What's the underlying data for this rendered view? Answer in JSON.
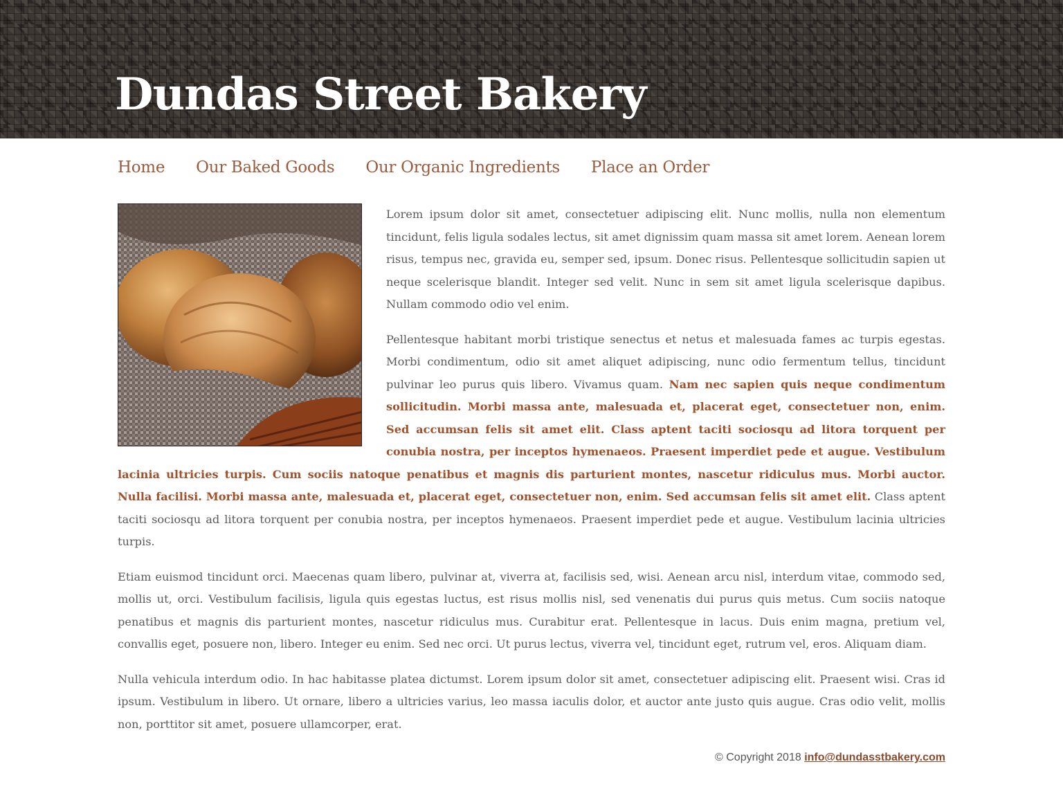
{
  "header": {
    "site_title": "Dundas Street Bakery"
  },
  "nav": {
    "items": [
      {
        "label": "Home"
      },
      {
        "label": "Our Baked Goods"
      },
      {
        "label": "Our Organic Ingredients"
      },
      {
        "label": "Place an Order"
      }
    ]
  },
  "content": {
    "image_subject": "bread-in-basket",
    "paragraphs": [
      {
        "text": "Lorem ipsum dolor sit amet, consectetuer adipiscing elit. Nunc mollis, nulla non elementum tincidunt, felis ligula sodales lectus, sit amet dignissim quam massa sit amet lorem. Aenean lorem risus, tempus nec, gravida eu, semper sed, ipsum. Donec risus. Pellentesque sollicitudin sapien ut neque scelerisque blandit. Integer sed velit. Nunc in sem sit amet ligula scelerisque dapibus. Nullam commodo odio vel enim."
      },
      {
        "before": "Pellentesque habitant morbi tristique senectus et netus et malesuada fames ac turpis egestas. Morbi condimentum, odio sit amet aliquet adipiscing, nunc odio fermentum tellus, tincidunt pulvinar leo purus quis libero. Vivamus quam. ",
        "highlight": "Nam nec sapien quis neque condimentum sollicitudin. Morbi massa ante, malesuada et, placerat eget, consectetuer non, enim. Sed accumsan felis sit amet elit. Class aptent taciti sociosqu ad litora torquent per conubia nostra, per inceptos hymenaeos. Praesent imperdiet pede et augue. Vestibulum lacinia ultricies turpis. Cum sociis natoque penatibus et magnis dis parturient montes, nascetur ridiculus mus. Morbi auctor. Nulla facilisi. Morbi massa ante, malesuada et, placerat eget, consectetuer non, enim. Sed accumsan felis sit amet elit.",
        "after": " Class aptent taciti sociosqu ad litora torquent per conubia nostra, per inceptos hymenaeos. Praesent imperdiet pede et augue. Vestibulum lacinia ultricies turpis."
      },
      {
        "text": "Etiam euismod tincidunt orci. Maecenas quam libero, pulvinar at, viverra at, facilisis sed, wisi. Aenean arcu nisl, interdum vitae, commodo sed, mollis ut, orci. Vestibulum facilisis, ligula quis egestas luctus, est risus mollis nisl, sed venenatis dui purus quis metus. Cum sociis natoque penatibus et magnis dis parturient montes, nascetur ridiculus mus. Curabitur erat. Pellentesque in lacus. Duis enim magna, pretium vel, convallis eget, posuere non, libero. Integer eu enim. Sed nec orci. Ut purus lectus, viverra vel, tincidunt eget, rutrum vel, eros. Aliquam diam."
      },
      {
        "text": "Nulla vehicula interdum odio. In hac habitasse platea dictumst. Lorem ipsum dolor sit amet, consectetuer adipiscing elit. Praesent wisi. Cras id ipsum. Vestibulum in libero. Ut ornare, libero a ultricies varius, leo massa iaculis dolor, et auctor ante justo quis augue. Cras odio velit, mollis non, porttitor sit amet, posuere ullamcorper, erat."
      }
    ]
  },
  "footer": {
    "copyright": "© Copyright 2018 ",
    "email": "info@dundasstbakery.com"
  },
  "colors": {
    "nav_link": "#9a5a3c",
    "highlight_text": "#a0522d",
    "body_text": "#5a5a5a",
    "header_bg": "#3d3733"
  }
}
